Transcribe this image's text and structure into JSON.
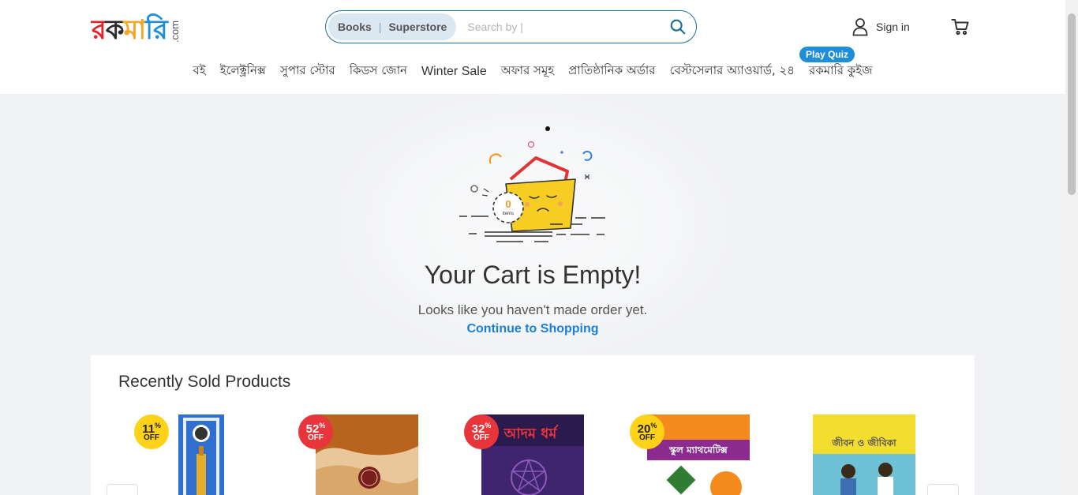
{
  "brand": {
    "logo_text_parts": [
      "র",
      "ক",
      "মা",
      "রি"
    ],
    "logo_suffix": ".com"
  },
  "search": {
    "scope_books": "Books",
    "scope_superstore": "Superstore",
    "placeholder": "Search by |"
  },
  "account": {
    "signin_label": "Sign in"
  },
  "nav": {
    "items": [
      {
        "label": "বই"
      },
      {
        "label": "ইলেক্ট্রনিক্স"
      },
      {
        "label": "সুপার স্টোর"
      },
      {
        "label": "কিডস জোন"
      },
      {
        "label": "Winter Sale"
      },
      {
        "label": "অফার সমূহ"
      },
      {
        "label": "প্রাতিষ্ঠানিক অর্ডার"
      },
      {
        "label": "বেস্টসেলার অ্যাওয়ার্ড, ২৪"
      },
      {
        "label": "রকমারি কুইজ"
      }
    ],
    "quiz_badge": "Play Quiz"
  },
  "cart": {
    "items_count": "0",
    "items_label": "items",
    "title": "Your Cart is Empty!",
    "subtitle": "Looks like you haven't made order yet.",
    "continue_label": "Continue to Shopping"
  },
  "recent": {
    "title": "Recently Sold Products",
    "products": [
      {
        "discount": "11",
        "off": "OFF",
        "badge_color": "yellow",
        "cover": [
          "#2f6fd0",
          "#e5ad2a"
        ]
      },
      {
        "discount": "52",
        "off": "OFF",
        "badge_color": "red",
        "cover": [
          "#b8641e",
          "#e9c79a"
        ]
      },
      {
        "discount": "32",
        "off": "OFF",
        "badge_color": "red",
        "cover": [
          "#2b1a4d",
          "#5a2f88"
        ],
        "cover_title": "আদম ধর্ম"
      },
      {
        "discount": "20",
        "off": "OFF",
        "badge_color": "yellow",
        "cover": [
          "#f58a1e",
          "#ffffff"
        ],
        "cover_title": "স্কুল ম্যাথমেটিক্স"
      },
      {
        "cover": [
          "#f3dd2e",
          "#6fc1d6"
        ],
        "cover_title": "জীবন ও জীবিকা"
      }
    ]
  }
}
